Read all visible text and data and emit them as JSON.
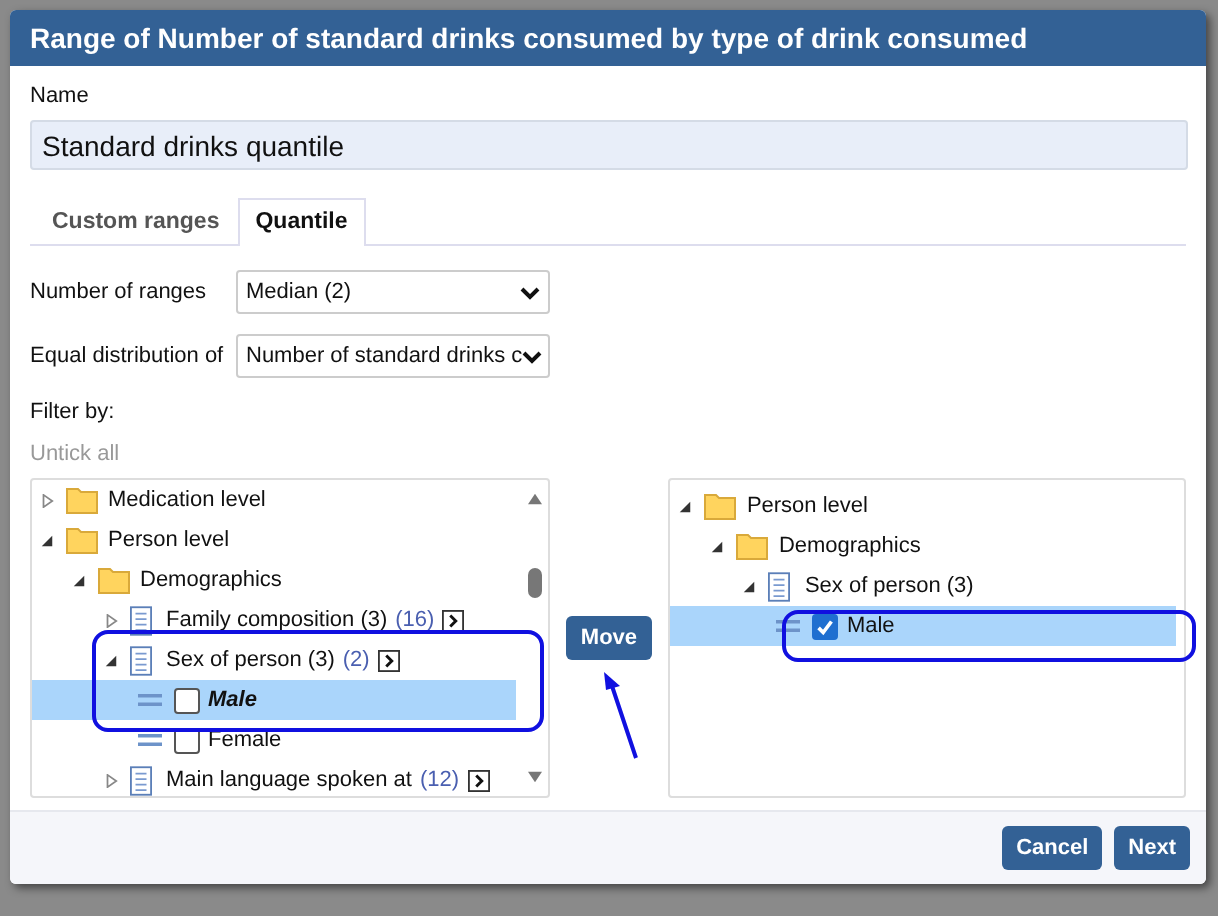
{
  "dialog": {
    "title": "Range of Number of standard drinks consumed by type of drink consumed"
  },
  "name_field": {
    "label": "Name",
    "value": "Standard drinks quantile"
  },
  "tabs": [
    {
      "label": "Custom ranges",
      "selected": false
    },
    {
      "label": "Quantile",
      "selected": true
    }
  ],
  "settings": [
    {
      "label": "Number of ranges",
      "value": "Median (2)"
    },
    {
      "label": "Equal distribution of",
      "value": "Number of standard drinks c"
    }
  ],
  "filter": {
    "label": "Filter by:",
    "untick_all": "Untick all",
    "untick_disabled": true
  },
  "source_tree": [
    {
      "kind": "folder",
      "label": "Medication level",
      "expanded": false
    },
    {
      "kind": "folder",
      "label": "Person level",
      "expanded": true,
      "children": [
        {
          "kind": "folder",
          "label": "Demographics",
          "expanded": true,
          "children": [
            {
              "kind": "field",
              "label": "Family composition (3)",
              "count": "(16)",
              "expanded": false
            },
            {
              "kind": "field",
              "label": "Sex of person (3)",
              "count": "(2)",
              "expanded": true,
              "children": [
                {
                  "kind": "value",
                  "label": "Male",
                  "checked": false,
                  "selected": true
                },
                {
                  "kind": "value",
                  "label": "Female",
                  "checked": false,
                  "selected": false
                }
              ]
            },
            {
              "kind": "field",
              "label": "Main language spoken at",
              "count": "(12)",
              "expanded": false
            }
          ]
        }
      ]
    }
  ],
  "move_button": "Move",
  "target_tree": [
    {
      "kind": "folder",
      "label": "Person level",
      "expanded": true,
      "children": [
        {
          "kind": "folder",
          "label": "Demographics",
          "expanded": true,
          "children": [
            {
              "kind": "field",
              "label": "Sex of person (3)",
              "expanded": true,
              "children": [
                {
                  "kind": "value",
                  "label": "Male",
                  "checked": true,
                  "selected": true
                }
              ]
            }
          ]
        }
      ]
    }
  ],
  "buttons": [
    "Cancel",
    "Next"
  ]
}
